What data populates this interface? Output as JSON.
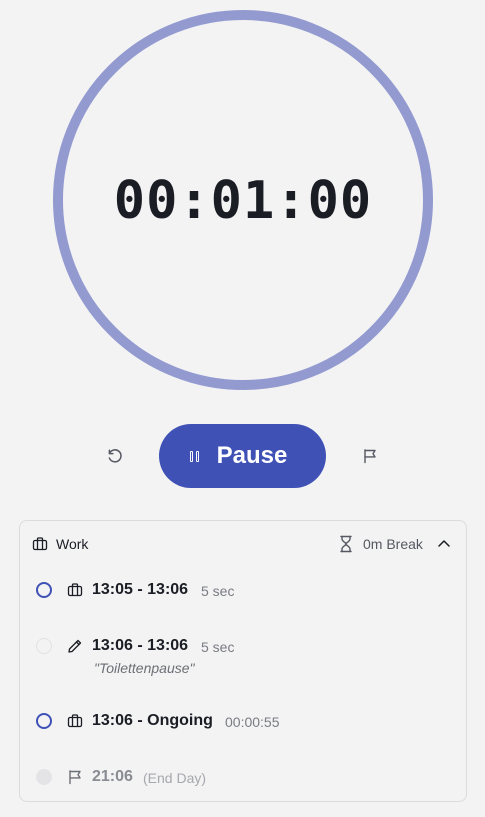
{
  "timer": {
    "display": "00:01:00"
  },
  "controls": {
    "pause_label": "Pause"
  },
  "card": {
    "title": "Work",
    "break_label": "0m Break",
    "entries": [
      {
        "type": "work",
        "time": "13:05 - 13:06",
        "extra": "5 sec",
        "note": ""
      },
      {
        "type": "edited",
        "time": "13:06 - 13:06",
        "extra": "5 sec",
        "note": "\"Toilettenpause\""
      },
      {
        "type": "work",
        "time": "13:06 - Ongoing",
        "extra": "00:00:55",
        "note": ""
      },
      {
        "type": "end",
        "time": "21:06",
        "extra": "(End Day)",
        "note": ""
      }
    ]
  },
  "icons": {
    "reset": "refresh-icon",
    "pause": "pause-icon",
    "flag": "flag-icon",
    "work": "briefcase-icon",
    "break": "hourglass-icon",
    "collapse": "chevron-up-icon",
    "edit": "pencil-icon"
  },
  "colors": {
    "accent": "#3f51b5",
    "ring": "#929ad0",
    "background": "#f3f3f4"
  }
}
